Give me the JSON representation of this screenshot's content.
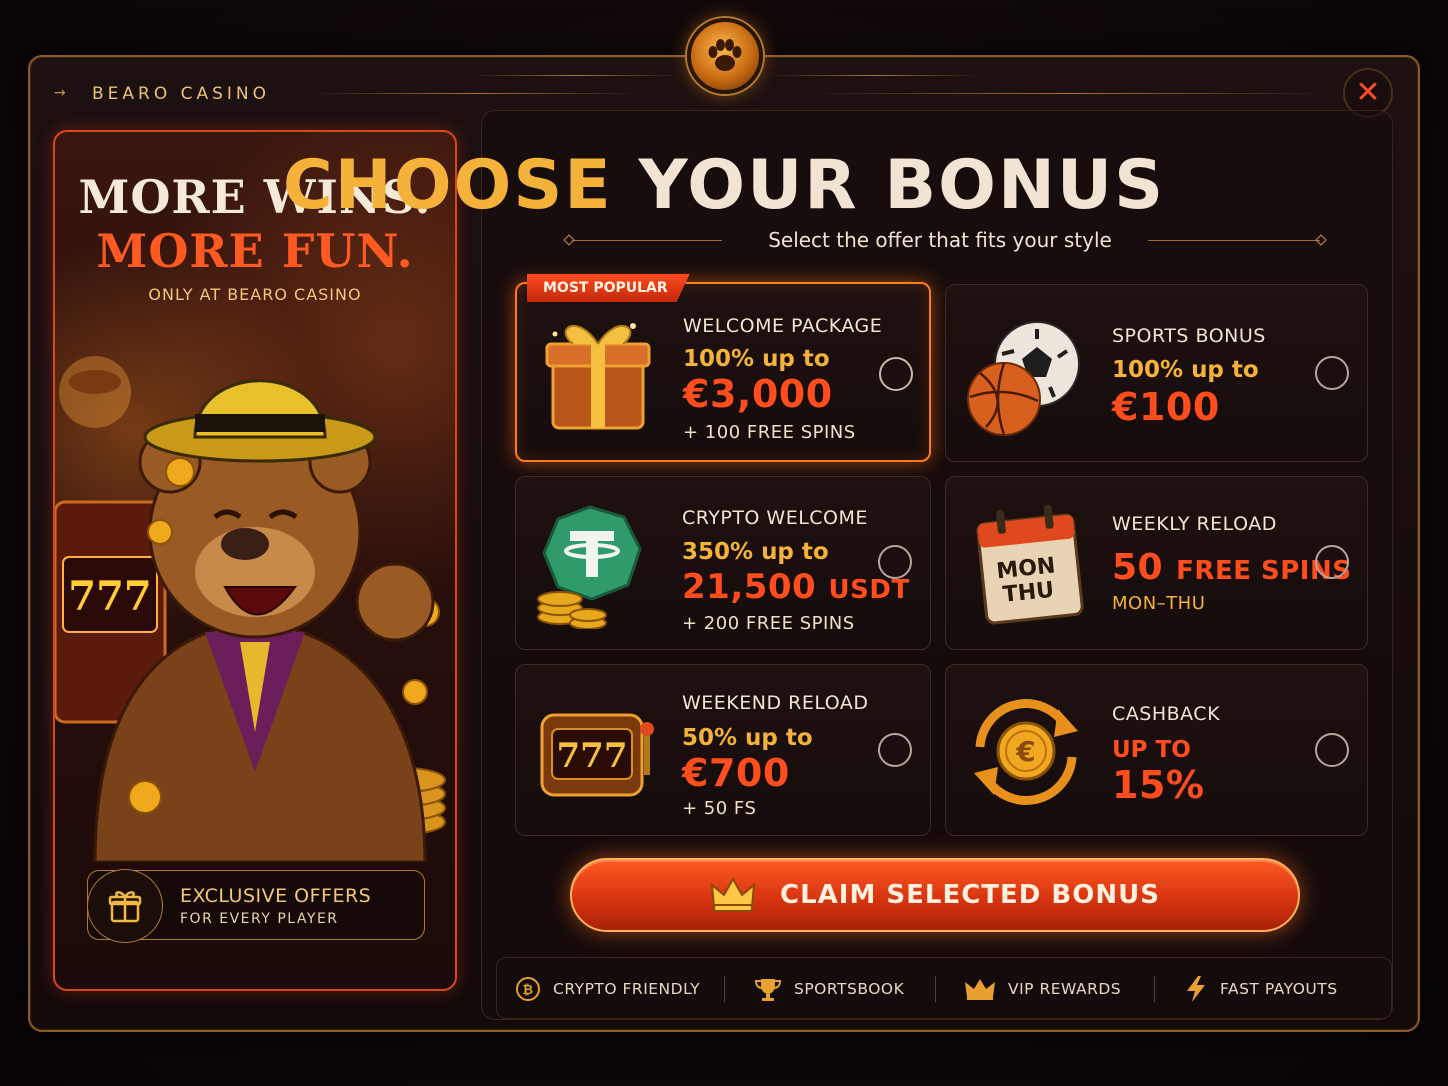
{
  "brand": "BEARO CASINO",
  "close_label": "✕",
  "promo": {
    "line1": "MORE WINS.",
    "line2": "MORE FUN.",
    "sub": "ONLY AT BEARO CASINO",
    "exclusive_title": "EXCLUSIVE OFFERS",
    "exclusive_sub": "FOR EVERY PLAYER"
  },
  "header": {
    "title_part1": "CHOOSE",
    "title_part2": "YOUR BONUS",
    "subtitle": "Select the offer that fits your style"
  },
  "bonuses": [
    {
      "ribbon": "MOST POPULAR",
      "label": "WELCOME PACKAGE",
      "pct": "100% up to",
      "amount": "€3,000",
      "extra": "+ 100 FREE SPINS",
      "icon": "gift-icon",
      "selected": true
    },
    {
      "label": "SPORTS BONUS",
      "pct": "100% up to",
      "amount": "€100",
      "icon": "sports-balls-icon",
      "selected": false
    },
    {
      "label": "CRYPTO WELCOME",
      "pct": "350% up to",
      "amount": "21,500",
      "amount_unit": "USDT",
      "extra": "+ 200 FREE SPINS",
      "icon": "tether-coin-icon",
      "selected": false
    },
    {
      "label": "WEEKLY RELOAD",
      "amount": "50",
      "amount_unit": "FREE SPINS",
      "extra": "MON–THU",
      "icon": "calendar-icon",
      "calendar_l1": "MON",
      "calendar_l2": "THU",
      "selected": false
    },
    {
      "label": "WEEKEND RELOAD",
      "pct": "50% up to",
      "amount": "€700",
      "extra": "+ 50 FS",
      "icon": "slot-machine-icon",
      "selected": false
    },
    {
      "label": "CASHBACK",
      "pct": "UP TO",
      "amount": "15%",
      "icon": "euro-cashback-icon",
      "selected": false
    }
  ],
  "claim_label": "CLAIM SELECTED BONUS",
  "features": [
    {
      "label": "CRYPTO FRIENDLY",
      "icon": "bitcoin-icon"
    },
    {
      "label": "SPORTSBOOK",
      "icon": "trophy-icon"
    },
    {
      "label": "VIP REWARDS",
      "icon": "crown-icon"
    },
    {
      "label": "FAST PAYOUTS",
      "icon": "lightning-icon"
    }
  ],
  "colors": {
    "accent_gold": "#f4b23a",
    "accent_red": "#ff4d1e",
    "frame_gold": "#8a5a2a",
    "background": "#140a0a"
  }
}
